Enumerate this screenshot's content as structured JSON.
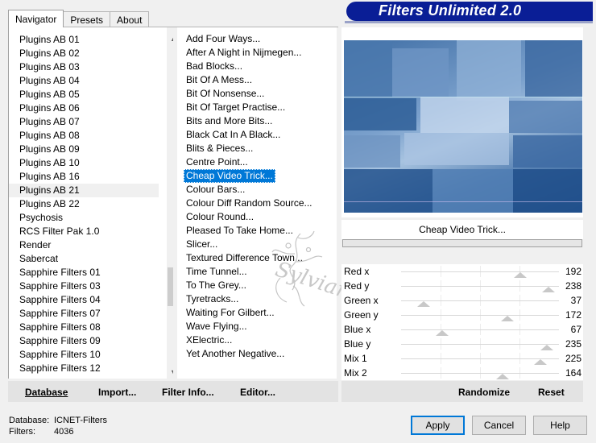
{
  "tabs": [
    "Navigator",
    "Presets",
    "About"
  ],
  "banner_title": "Filters Unlimited 2.0",
  "categories": [
    "Plugins AB 01",
    "Plugins AB 02",
    "Plugins AB 03",
    "Plugins AB 04",
    "Plugins AB 05",
    "Plugins AB 06",
    "Plugins AB 07",
    "Plugins AB 08",
    "Plugins AB 09",
    "Plugins AB 10",
    "Plugins AB 16",
    "Plugins AB 21",
    "Plugins AB 22",
    "Psychosis",
    "RCS Filter Pak 1.0",
    "Render",
    "Sabercat",
    "Sapphire Filters 01",
    "Sapphire Filters 03",
    "Sapphire Filters 04",
    "Sapphire Filters 07",
    "Sapphire Filters 08",
    "Sapphire Filters 09",
    "Sapphire Filters 10",
    "Sapphire Filters 12"
  ],
  "selected_category": "Plugins AB 21",
  "filters": [
    "Add Four Ways...",
    "After A Night in Nijmegen...",
    "Bad Blocks...",
    "Bit Of A Mess...",
    "Bit Of Nonsense...",
    "Bit Of Target Practise...",
    "Bits and More Bits...",
    "Black Cat In A Black...",
    "Blits & Pieces...",
    "Centre Point...",
    "Cheap Video Trick...",
    "Colour Bars...",
    "Colour Diff Random Source...",
    "Colour Round...",
    "Pleased To Take Home...",
    "Slicer...",
    "Textured Difference Town...",
    "Time Tunnel...",
    "To The Grey...",
    "Tyretracks...",
    "Waiting For Gilbert...",
    "Wave Flying...",
    "XElectric...",
    "Yet Another Negative..."
  ],
  "selected_filter": "Cheap Video Trick...",
  "current_filter_name": "Cheap Video Trick...",
  "watermark_text": "Sylviane",
  "sliders": [
    {
      "label": "Red x",
      "value": 192
    },
    {
      "label": "Red y",
      "value": 238
    },
    {
      "label": "Green x",
      "value": 37
    },
    {
      "label": "Green y",
      "value": 172
    },
    {
      "label": "Blue x",
      "value": 67
    },
    {
      "label": "Blue y",
      "value": 235
    },
    {
      "label": "Mix 1",
      "value": 225
    },
    {
      "label": "Mix 2",
      "value": 164
    }
  ],
  "slider_max": 255,
  "toolbar": {
    "database": "Database",
    "import": "Import...",
    "filter_info": "Filter Info...",
    "editor": "Editor...",
    "randomize": "Randomize",
    "reset": "Reset"
  },
  "status": {
    "database_label": "Database:",
    "database_value": "ICNET-Filters",
    "filters_label": "Filters:",
    "filters_value": "4036"
  },
  "buttons": {
    "apply": "Apply",
    "cancel": "Cancel",
    "help": "Help"
  },
  "colors": {
    "banner": "#0a1e96",
    "selection": "#0078d7"
  }
}
